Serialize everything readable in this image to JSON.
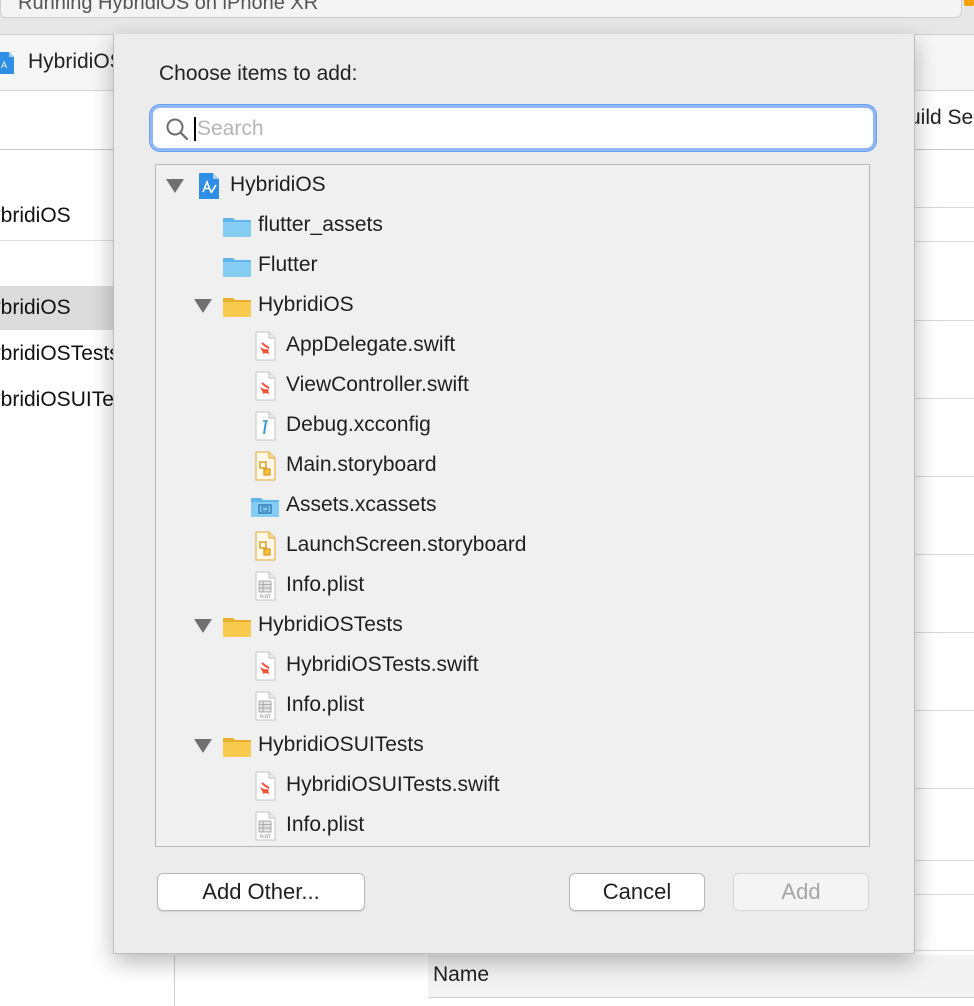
{
  "window": {
    "activity_text": "Running HybridiOS on iPhone XR",
    "jump_bar_label": "HybridiOS",
    "tab_partial": "Build Se",
    "left_items": [
      "HybridiOS",
      "HybridiOS",
      "HybridiOSTests",
      "HybridiOSUITests"
    ],
    "column_header": "Name"
  },
  "sheet": {
    "title": "Choose items to add:",
    "search": {
      "placeholder": "Search",
      "value": ""
    },
    "tree": [
      {
        "label": "HybridiOS",
        "icon": "xcode-project-icon",
        "depth": 0,
        "disclosure": "expanded"
      },
      {
        "label": "flutter_assets",
        "icon": "blue-folder-icon",
        "depth": 1,
        "disclosure": "none"
      },
      {
        "label": "Flutter",
        "icon": "blue-folder-icon",
        "depth": 1,
        "disclosure": "none"
      },
      {
        "label": "HybridiOS",
        "icon": "yellow-folder-icon",
        "depth": 1,
        "disclosure": "expanded"
      },
      {
        "label": "AppDelegate.swift",
        "icon": "swift-file-icon",
        "depth": 2,
        "disclosure": "none"
      },
      {
        "label": "ViewController.swift",
        "icon": "swift-file-icon",
        "depth": 2,
        "disclosure": "none"
      },
      {
        "label": "Debug.xcconfig",
        "icon": "xcconfig-file-icon",
        "depth": 2,
        "disclosure": "none"
      },
      {
        "label": "Main.storyboard",
        "icon": "storyboard-file-icon",
        "depth": 2,
        "disclosure": "none"
      },
      {
        "label": "Assets.xcassets",
        "icon": "asset-catalog-icon",
        "depth": 2,
        "disclosure": "none"
      },
      {
        "label": "LaunchScreen.storyboard",
        "icon": "storyboard-file-icon",
        "depth": 2,
        "disclosure": "none"
      },
      {
        "label": "Info.plist",
        "icon": "plist-file-icon",
        "depth": 2,
        "disclosure": "none"
      },
      {
        "label": "HybridiOSTests",
        "icon": "yellow-folder-icon",
        "depth": 1,
        "disclosure": "expanded"
      },
      {
        "label": "HybridiOSTests.swift",
        "icon": "swift-file-icon",
        "depth": 2,
        "disclosure": "none"
      },
      {
        "label": "Info.plist",
        "icon": "plist-file-icon",
        "depth": 2,
        "disclosure": "none"
      },
      {
        "label": "HybridiOSUITests",
        "icon": "yellow-folder-icon",
        "depth": 1,
        "disclosure": "expanded"
      },
      {
        "label": "HybridiOSUITests.swift",
        "icon": "swift-file-icon",
        "depth": 2,
        "disclosure": "none"
      },
      {
        "label": "Info.plist",
        "icon": "plist-file-icon",
        "depth": 2,
        "disclosure": "none"
      }
    ],
    "buttons": {
      "add_other": "Add Other...",
      "cancel": "Cancel",
      "add": "Add",
      "add_enabled": false
    }
  },
  "colors": {
    "focus_ring": "#6aa0ef",
    "folder_yellow": "#f7c948",
    "folder_blue": "#7cc6f1",
    "swift": "#f05138"
  }
}
